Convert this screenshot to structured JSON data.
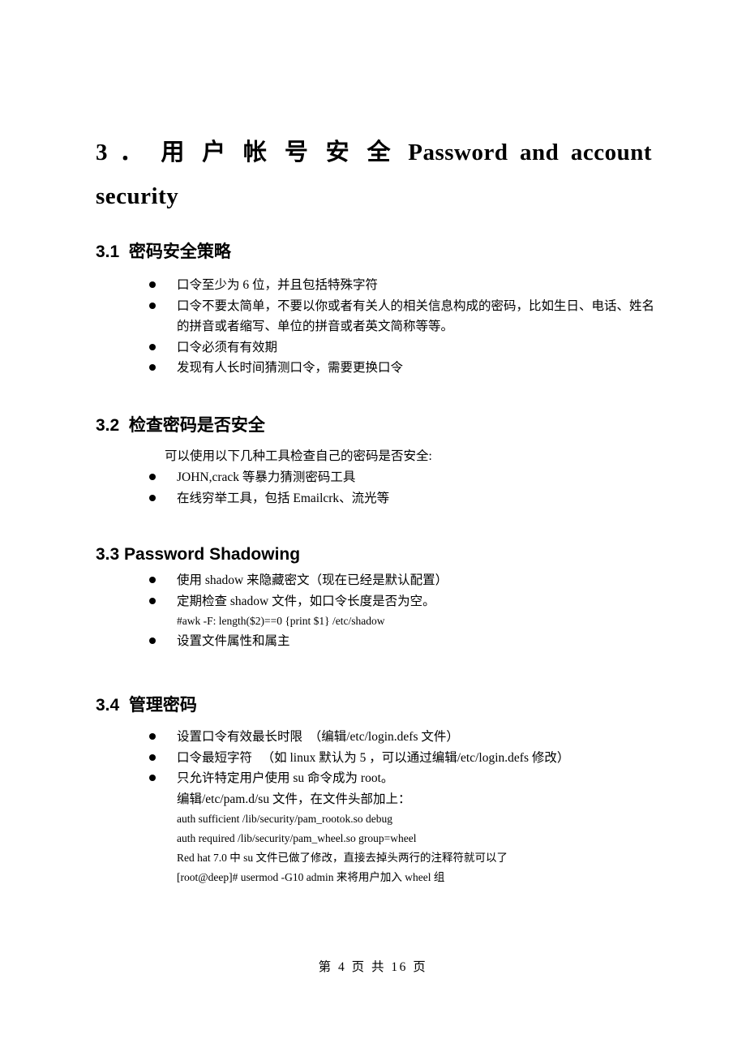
{
  "document": {
    "title_line_1": "3 ． 用 户 帐 号 安 全 Password and account",
    "title_line_2": "security",
    "sections": [
      {
        "heading": "3.1  密码安全策略",
        "bullets": [
          "口令至少为 6 位，并且包括特殊字符",
          "口令不要太简单，不要以你或者有关人的相关信息构成的密码，比如生日、电话、姓名的拼音或者缩写、单位的拼音或者英文简称等等。",
          "口令必须有有效期",
          "发现有人长时间猜测口令，需要更换口令"
        ]
      },
      {
        "heading": "3.2  检查密码是否安全",
        "intro": "可以使用以下几种工具检查自己的密码是否安全:",
        "bullets": [
          "JOHN,crack 等暴力猜测密码工具",
          "在线穷举工具，包括 Emailcrk、流光等"
        ]
      },
      {
        "heading": "3.3 Password Shadowing",
        "bullets": [
          "使用 shadow 来隐藏密文（现在已经是默认配置）",
          "定期检查 shadow 文件，如口令长度是否为空。",
          "设置文件属性和属主"
        ],
        "code_after_bullet_2": "#awk -F: length($2)==0 {print $1} /etc/shadow"
      },
      {
        "heading": "3.4  管理密码",
        "bullets": [
          "设置口令有效最长时限  （编辑/etc/login.defs 文件）",
          "口令最短字符   （如 linux 默认为 5 ，可以通过编辑/etc/login.defs 修改）",
          "只允许特定用户使用 su 命令成为 root。"
        ],
        "sub_after_bullet_3": "编辑/etc/pam.d/su 文件，在文件头部加上：",
        "code_lines": [
          "auth sufficient /lib/security/pam_rootok.so debug",
          "auth required /lib/security/pam_wheel.so group=wheel",
          "Red hat 7.0 中 su 文件已做了修改，直接去掉头两行的注释符就可以了",
          "[root@deep]# usermod -G10 admin 来将用户加入 wheel 组"
        ]
      }
    ],
    "footer": "第 4 页 共 16 页"
  }
}
